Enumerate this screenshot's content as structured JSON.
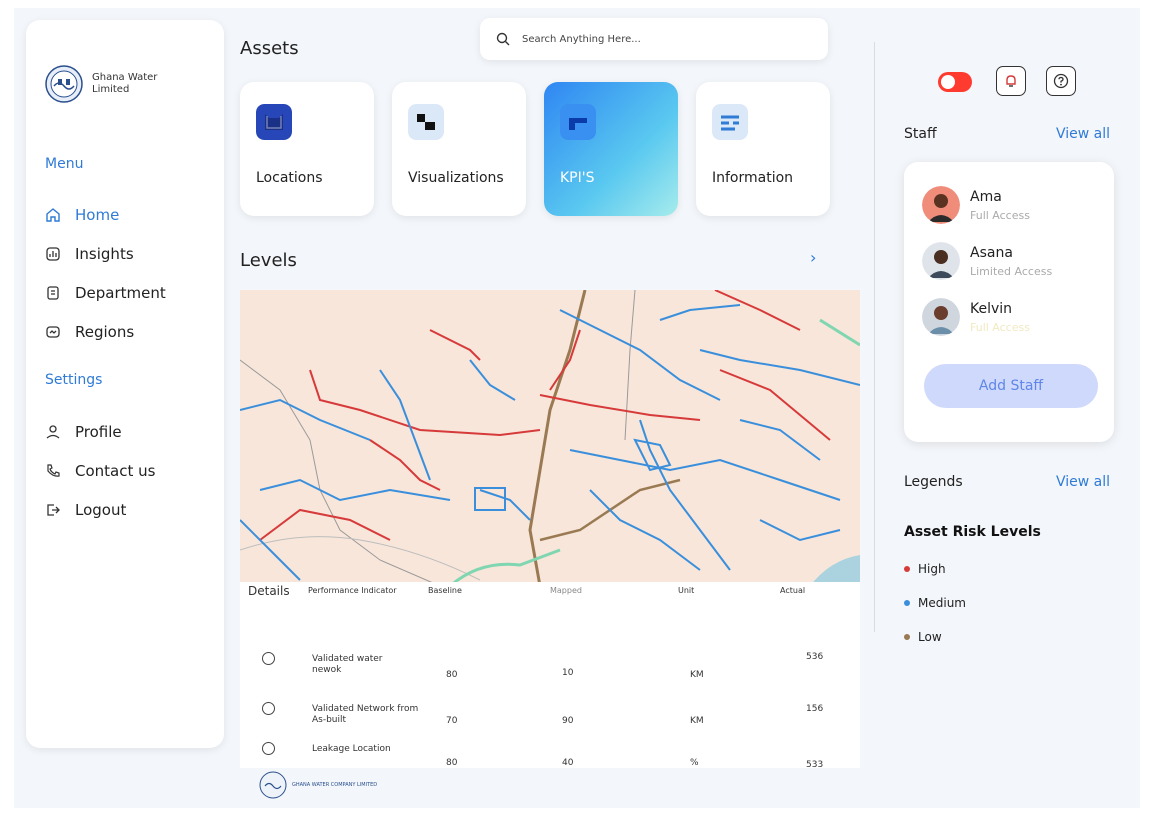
{
  "brand": {
    "name": "Ghana Water Limited"
  },
  "menu": {
    "label": "Menu",
    "items": [
      {
        "label": "Home",
        "icon": "home-icon",
        "active": true
      },
      {
        "label": "Insights",
        "icon": "chart-icon"
      },
      {
        "label": "Department",
        "icon": "document-icon"
      },
      {
        "label": "Regions",
        "icon": "map-icon"
      }
    ]
  },
  "settings": {
    "label": "Settings",
    "items": [
      {
        "label": "Profile",
        "icon": "user-icon"
      },
      {
        "label": "Contact us",
        "icon": "phone-icon"
      },
      {
        "label": "Logout",
        "icon": "logout-icon"
      }
    ]
  },
  "assets": {
    "title": "Assets",
    "cards": [
      {
        "label": "Locations",
        "icon": "location-icon"
      },
      {
        "label": "Visualizations",
        "icon": "visualization-icon"
      },
      {
        "label": "KPI'S",
        "icon": "kpi-icon",
        "active": true
      },
      {
        "label": "Information",
        "icon": "information-icon"
      }
    ]
  },
  "search": {
    "placeholder": "Search Anything Here..."
  },
  "levels": {
    "title": "Levels"
  },
  "details": {
    "label": "Details",
    "headers": [
      "Performance Indicator",
      "Baseline",
      "Mapped",
      "Unit",
      "Actual"
    ],
    "rows": [
      {
        "indicator": "Validated water newok",
        "baseline": "80",
        "mapped": "10",
        "unit": "KM",
        "actual": "536"
      },
      {
        "indicator": "Validated Network from As-built",
        "baseline": "70",
        "mapped": "90",
        "unit": "KM",
        "actual": "156"
      },
      {
        "indicator": "Leakage Location",
        "baseline": "80",
        "mapped": "40",
        "unit": "%",
        "actual": "533"
      }
    ]
  },
  "footer": {
    "company": "GHANA WATER COMPANY LIMITED"
  },
  "staff": {
    "title": "Staff",
    "view_all": "View all",
    "members": [
      {
        "name": "Ama",
        "role": "Full Access"
      },
      {
        "name": "Asana",
        "role": "Limited Access"
      },
      {
        "name": "Kelvin",
        "role": "Full Access"
      }
    ],
    "add_label": "Add Staff"
  },
  "legends": {
    "title": "Legends",
    "view_all": "View all",
    "heading": "Asset Risk Levels",
    "items": [
      {
        "label": "High",
        "color": "#d63a3a"
      },
      {
        "label": "Medium",
        "color": "#3a8fdc"
      },
      {
        "label": "Low",
        "color": "#9a7a52"
      }
    ]
  },
  "colors": {
    "accent": "#2f7bd6",
    "toggle": "#ff3b30"
  }
}
